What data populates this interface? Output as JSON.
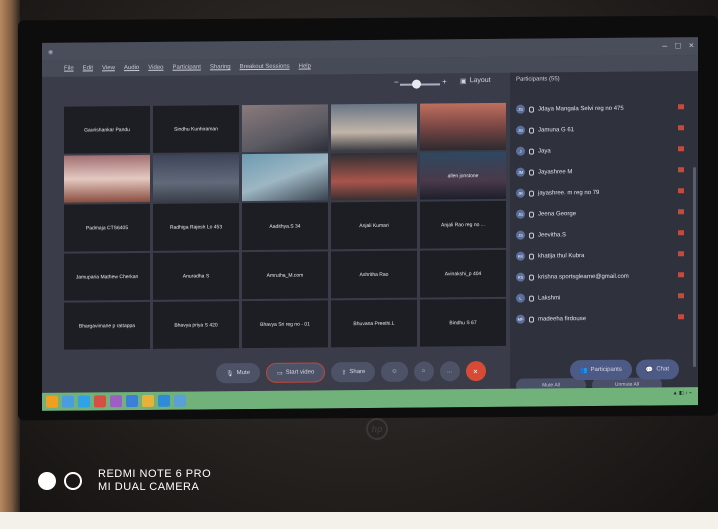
{
  "menu": [
    "File",
    "Edit",
    "View",
    "Audio",
    "Video",
    "Participant",
    "Sharing",
    "Breakout Sessions",
    "Help"
  ],
  "layout_label": "Layout",
  "participants_title": "Participants (55)",
  "participants": [
    {
      "initials": "JS",
      "name": "Jdaya Mangala Selvi reg no 475"
    },
    {
      "initials": "JG",
      "name": "Jamuna G 61"
    },
    {
      "initials": "J",
      "name": "Jaya"
    },
    {
      "initials": "JM",
      "name": "Jayashree M"
    },
    {
      "initials": "JR",
      "name": "jayashree. m reg no 79"
    },
    {
      "initials": "JG",
      "name": "Jeena George"
    },
    {
      "initials": "JS",
      "name": "Jeevitha.S"
    },
    {
      "initials": "KK",
      "name": "khatija thul Kubra"
    },
    {
      "initials": "KS",
      "name": "krishna sportsglearne@gmail.com"
    },
    {
      "initials": "L",
      "name": "Lakshmi"
    },
    {
      "initials": "MF",
      "name": "madeeha firdouse"
    }
  ],
  "tiles": [
    {
      "label": "Gaurishankar Pandu",
      "style": "empty"
    },
    {
      "label": "Sindhu Kunhiraman",
      "style": "empty"
    },
    {
      "label": "",
      "style": "v1"
    },
    {
      "label": "",
      "style": "v2"
    },
    {
      "label": "",
      "style": "v3"
    },
    {
      "label": "",
      "style": "v4"
    },
    {
      "label": "",
      "style": "v5"
    },
    {
      "label": "",
      "style": "v6"
    },
    {
      "label": "",
      "style": "v7"
    },
    {
      "label": "allen jonstone",
      "style": "v8"
    },
    {
      "label": "Padmaja CTS6405",
      "style": "empty"
    },
    {
      "label": "Radhiga Rajesh Lo 453",
      "style": "empty"
    },
    {
      "label": "Aadithya.S 34",
      "style": "empty"
    },
    {
      "label": "Anjali Kumari",
      "style": "empty"
    },
    {
      "label": "Anjali Rao reg no ...",
      "style": "empty"
    },
    {
      "label": "Jamuparia Mathew Cherkan",
      "style": "empty"
    },
    {
      "label": "Anuradha S",
      "style": "empty"
    },
    {
      "label": "Amrutha_M.com",
      "style": "empty"
    },
    {
      "label": "Ashritha Rao",
      "style": "empty"
    },
    {
      "label": "Avinakshi_p 404",
      "style": "empty"
    },
    {
      "label": "Bhargavimane p rattappa",
      "style": "empty"
    },
    {
      "label": "Bhavya priya S 420",
      "style": "empty"
    },
    {
      "label": "Bhavya Sri reg no - 01",
      "style": "empty"
    },
    {
      "label": "Bhuvana Preethi.L",
      "style": "empty"
    },
    {
      "label": "Bindhu S 67",
      "style": "empty"
    }
  ],
  "controls": {
    "mute": "Mute",
    "video": "Start video",
    "share": "Share",
    "more": "...",
    "participants": "Participants",
    "chat": "Chat",
    "end": "×"
  },
  "p_buttons": [
    "Mute All",
    "Unmute All"
  ],
  "hp": "hp",
  "watermark": {
    "line1": "REDMI NOTE 6 PRO",
    "line2": "MI DUAL CAMERA"
  },
  "taskbar_icon_colors": [
    "#f0a020",
    "#4a9be0",
    "#2fa3e6",
    "#d54f45",
    "#9d5fc4",
    "#3c7fd6",
    "#e6b23a",
    "#2f8bd8",
    "#5aa0d8"
  ]
}
